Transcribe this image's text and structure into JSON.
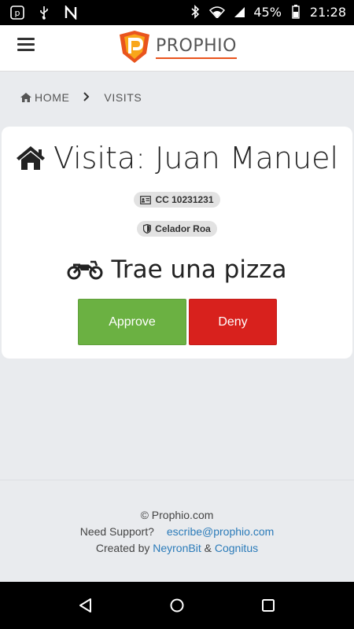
{
  "status": {
    "battery": "45%",
    "time": "21:28"
  },
  "brand": {
    "name": "PROPHIO"
  },
  "breadcrumb": {
    "home": "HOME",
    "current": "VISITS"
  },
  "visit": {
    "title": "Visita: Juan Manuel",
    "id_chip": "CC 10231231",
    "guard_chip": "Celador Roa",
    "reason": "Trae una pizza"
  },
  "actions": {
    "approve": "Approve",
    "deny": "Deny"
  },
  "colors": {
    "approve": "#6bb142",
    "deny": "#d8211d",
    "link": "#2b7bb9",
    "brand_accent": "#e9541d"
  },
  "footer": {
    "copyright": "© Prophio.com",
    "support_label": "Need Support?",
    "support_email": "escribe@prophio.com",
    "created_by": "Created by",
    "company1": "NeyronBit",
    "amp": "&",
    "company2": "Cognitus"
  },
  "icons": [
    "home-icon",
    "id-card-icon",
    "shield-icon",
    "motorcycle-icon",
    "hamburger-icon",
    "chevron-right-icon"
  ]
}
